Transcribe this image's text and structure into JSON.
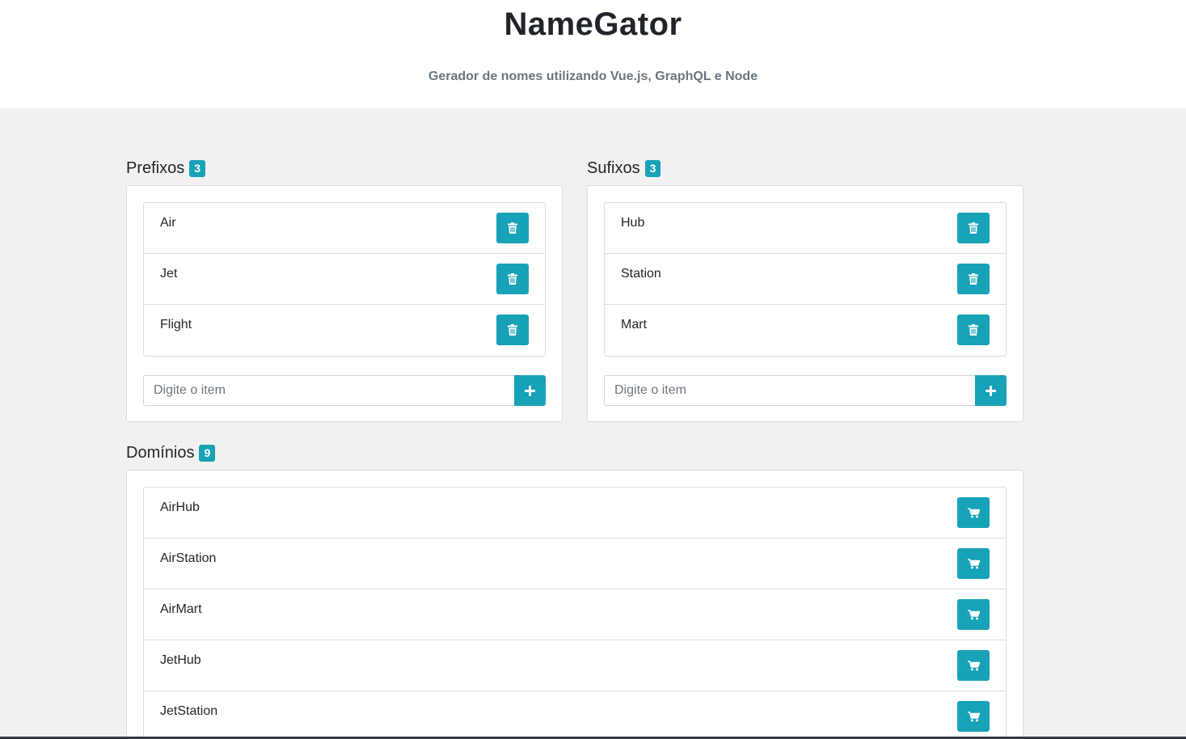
{
  "header": {
    "title": "NameGator",
    "subtitle": "Gerador de nomes utilizando Vue.js, GraphQL e Node"
  },
  "prefixes": {
    "title": "Prefixos",
    "count": "3",
    "items": [
      "Air",
      "Jet",
      "Flight"
    ],
    "input_placeholder": "Digite o item",
    "item_icon": "trash-icon",
    "add_icon": "plus-icon"
  },
  "suffixes": {
    "title": "Sufixos",
    "count": "3",
    "items": [
      "Hub",
      "Station",
      "Mart"
    ],
    "input_placeholder": "Digite o item",
    "item_icon": "trash-icon",
    "add_icon": "plus-icon"
  },
  "domains": {
    "title": "Domínios",
    "count": "9",
    "items": [
      "AirHub",
      "AirStation",
      "AirMart",
      "JetHub",
      "JetStation"
    ],
    "item_icon": "cart-icon"
  },
  "colors": {
    "accent": "#17a2b8",
    "background": "#f1f1f1",
    "header_background": "#ffffff"
  }
}
